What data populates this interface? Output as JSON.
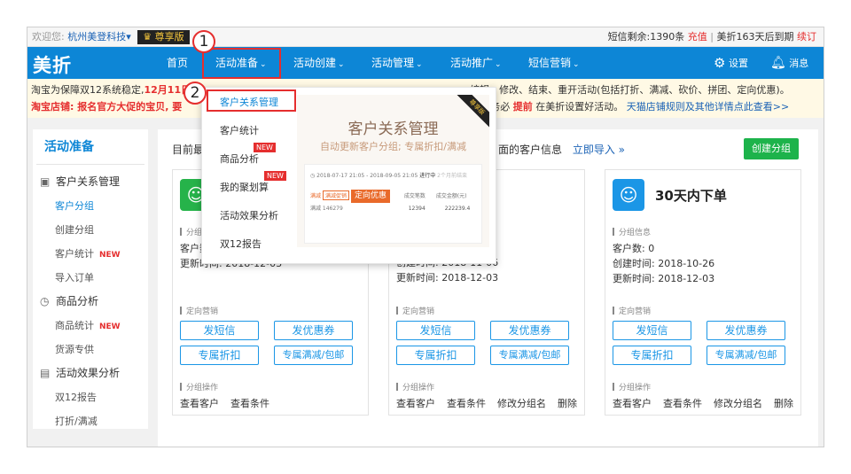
{
  "topbar": {
    "welcome": "欢迎您:",
    "shop": "杭州美登科技",
    "vip": "尊享版",
    "sms_prefix": "短信剩余:",
    "sms_count": "1390条",
    "recharge": "充值",
    "sep": "|",
    "expire": "美折163天后到期",
    "renew": "续订"
  },
  "nav": {
    "logo": "美折",
    "items": [
      {
        "label": "首页",
        "chev": ""
      },
      {
        "label": "活动准备",
        "chev": "⌄"
      },
      {
        "label": "活动创建",
        "chev": "⌄"
      },
      {
        "label": "活动管理",
        "chev": "⌄"
      },
      {
        "label": "活动推广",
        "chev": "⌄"
      },
      {
        "label": "短信营销",
        "chev": "⌄"
      }
    ],
    "settings": "设置",
    "messages": "消息"
  },
  "notice": {
    "line1_a": "淘宝为保障双12系统稳定,",
    "line1_b": "12月11日",
    "line1_c": "编辑、修改、结束、重开活动(包括打折、满减、砍价、拼团、定向优惠)。",
    "line2_a": "淘宝店铺: 报名官方大促的宝贝, 要",
    "line2_b": "生效, 请务必",
    "line2_c": "提前",
    "line2_d": "在美折设置好活动。",
    "line2_e": "天猫店铺规则及其他详情点此查看>>"
  },
  "sidebar": {
    "title": "活动准备",
    "sections": [
      {
        "label": "客户关系管理",
        "icon": "▣",
        "items": [
          {
            "label": "客户分组",
            "new": "",
            "active": true
          },
          {
            "label": "创建分组",
            "new": ""
          },
          {
            "label": "客户统计",
            "new": "NEW"
          },
          {
            "label": "导入订单",
            "new": ""
          }
        ]
      },
      {
        "label": "商品分析",
        "icon": "◷",
        "items": [
          {
            "label": "商品统计",
            "new": "NEW"
          },
          {
            "label": "货源专供",
            "new": ""
          }
        ]
      },
      {
        "label": "活动效果分析",
        "icon": "▤",
        "items": [
          {
            "label": "双12报告",
            "new": ""
          },
          {
            "label": "打折/满减",
            "new": ""
          }
        ]
      }
    ]
  },
  "main": {
    "head_a": "目前最",
    "head_b": "面的客户信息",
    "import_link": "立即导入 »",
    "create_button": "创建分组",
    "cards": [
      {
        "title": "",
        "info_label": "分组信息",
        "count": "客户数",
        "created": "",
        "updated": "更新时间: 2018-12-03",
        "marketing_label": "定向营销",
        "b1": "发短信",
        "b2": "发优惠券",
        "b3": "专属折扣",
        "b4": "专属满减/包邮",
        "ops_label": "分组操作",
        "ops": [
          "查看客户",
          "查看条件"
        ]
      },
      {
        "title": "",
        "info_label": "",
        "count": "",
        "created": "创建时间: 2018-11-06",
        "updated": "更新时间: 2018-12-03",
        "marketing_label": "定向营销",
        "b1": "发短信",
        "b2": "发优惠券",
        "b3": "专属折扣",
        "b4": "专属满减/包邮",
        "ops_label": "分组操作",
        "ops": [
          "查看客户",
          "查看条件",
          "修改分组名",
          "删除"
        ]
      },
      {
        "title": "30天内下单",
        "info_label": "分组信息",
        "count": "客户数: 0",
        "created": "创建时间: 2018-10-26",
        "updated": "更新时间: 2018-12-03",
        "marketing_label": "定向营销",
        "b1": "发短信",
        "b2": "发优惠券",
        "b3": "专属折扣",
        "b4": "专属满减/包邮",
        "ops_label": "分组操作",
        "ops": [
          "查看客户",
          "查看条件",
          "修改分组名",
          "删除"
        ]
      }
    ]
  },
  "dropdown": {
    "items": [
      {
        "label": "客户关系管理",
        "new": ""
      },
      {
        "label": "客户统计",
        "new": ""
      },
      {
        "label": "商品分析",
        "new": "NEW"
      },
      {
        "label": "我的聚划算",
        "new": "NEW"
      },
      {
        "label": "活动效果分析",
        "new": ""
      },
      {
        "label": "双12报告",
        "new": ""
      }
    ],
    "promo": {
      "title": "客户关系管理",
      "subtitle": "自动更新客户分组; 专属折扣/满减",
      "ribbon": "尊享版",
      "date": "2018-07-17 21:05 - 2018-09-05 21:05",
      "status": "进行中",
      "status_note": "2个月前结束",
      "tag1": "满减",
      "tag2": "满减促销",
      "tag3": "定向优惠",
      "sub": "满减 146279",
      "col1": "成交笔数",
      "col2": "成交金额(元)",
      "v1": "12394",
      "v2": "222239.4"
    }
  },
  "annotations": {
    "step1": "1",
    "step2": "2"
  }
}
